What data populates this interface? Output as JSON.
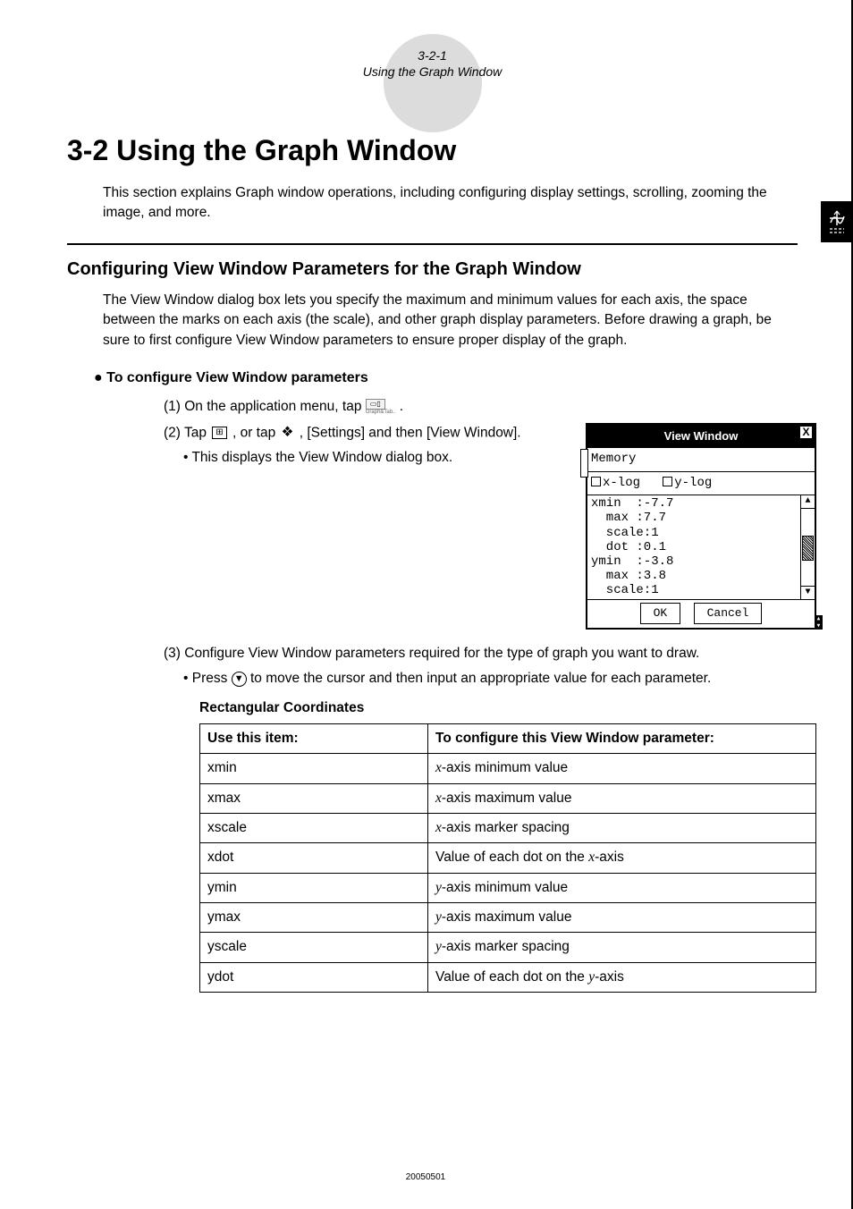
{
  "header": {
    "num": "3-2-1",
    "sub": "Using the Graph Window"
  },
  "section_title": "3-2  Using the Graph Window",
  "intro": "This section explains Graph window operations, including configuring display settings, scrolling, zooming the image, and more.",
  "subsection": "Configuring View Window Parameters for the Graph Window",
  "para1": "The View Window dialog box lets you specify the maximum and minimum values for each axis, the space between the marks on each axis (the scale), and other graph display parameters. Before drawing a graph, be sure to first configure View Window parameters to ensure proper display of the graph.",
  "task_bullet": "●",
  "task_title": "To configure View Window parameters",
  "step1_a": "(1) On the application menu, tap ",
  "step1_b": " .",
  "step2_a": "(2) Tap ",
  "step2_b": ", or tap ",
  "step2_c": ", [Settings] and then [View Window].",
  "step2_note": "This displays the View Window dialog box.",
  "dialog": {
    "title": "View  Window",
    "menu": "Memory",
    "xlog": "x-log",
    "ylog": "y-log",
    "params": "xmin  :-7.7\n  max :7.7\n  scale:1\n  dot :0.1\nymin  :-3.8\n  max :3.8\n  scale:1",
    "ok": "OK",
    "cancel": "Cancel"
  },
  "step3": "(3) Configure View Window parameters required for the type of graph you want to draw.",
  "step3_note_a": "Press ",
  "step3_note_b": " to move the cursor and then input an appropriate value for each parameter.",
  "table_title": "Rectangular Coordinates",
  "table": {
    "h1": "Use this item:",
    "h2": "To configure this View Window parameter:",
    "rows": [
      {
        "c1": "xmin",
        "c2a": "x",
        "c2b": "-axis minimum value"
      },
      {
        "c1": "xmax",
        "c2a": "x",
        "c2b": "-axis maximum value"
      },
      {
        "c1": "xscale",
        "c2a": "x",
        "c2b": "-axis marker spacing"
      },
      {
        "c1": "xdot",
        "c2a": "",
        "c2b": "Value of each dot on the ",
        "c2c": "x",
        "c2d": "-axis"
      },
      {
        "c1": "ymin",
        "c2a": "y",
        "c2b": "-axis minimum value"
      },
      {
        "c1": "ymax",
        "c2a": "y",
        "c2b": "-axis maximum value"
      },
      {
        "c1": "yscale",
        "c2a": "y",
        "c2b": "-axis marker spacing"
      },
      {
        "c1": "ydot",
        "c2a": "",
        "c2b": "Value of each dot on the ",
        "c2c": "y",
        "c2d": "-axis"
      }
    ]
  },
  "footer": "20050501",
  "icons": {
    "app_menu_label": "Graph&Tab..",
    "view_window_icon": "⊞",
    "settings_icon": "❖",
    "down_arrow": "▼"
  }
}
